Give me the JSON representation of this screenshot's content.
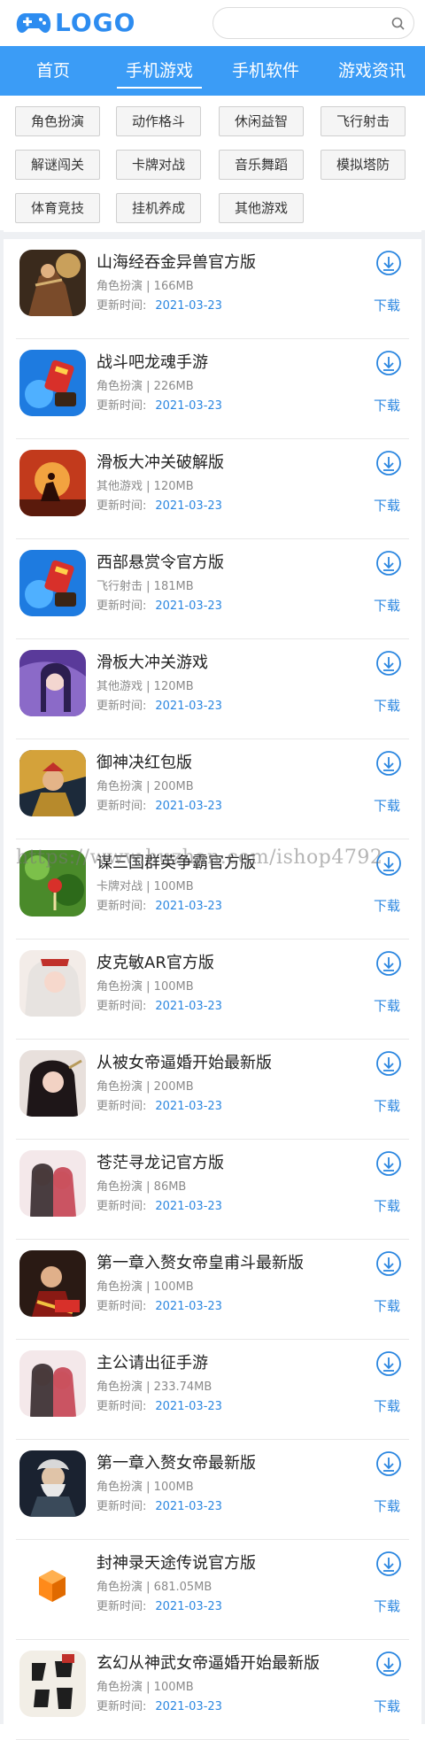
{
  "header": {
    "logo_text": "LOGO",
    "search_placeholder": "",
    "colors": {
      "brand": "#2d8cf0",
      "nav_bg": "#3b9cf6",
      "link": "#2a86e0"
    }
  },
  "nav": {
    "tabs": [
      {
        "label": "首页",
        "active": false
      },
      {
        "label": "手机游戏",
        "active": true
      },
      {
        "label": "手机软件",
        "active": false
      },
      {
        "label": "游戏资讯",
        "active": false
      }
    ]
  },
  "categories": [
    "角色扮演",
    "动作格斗",
    "休闲益智",
    "飞行射击",
    "解谜闯关",
    "卡牌对战",
    "音乐舞蹈",
    "模拟塔防",
    "体育竞技",
    "挂机养成",
    "其他游戏"
  ],
  "list": {
    "time_label": "更新时间:",
    "download_label": "下载",
    "items": [
      {
        "title": "山海经吞金异兽官方版",
        "category": "角色扮演",
        "size": "166MB",
        "date": "2021-03-23",
        "icon": "game-icon-warrior-dark"
      },
      {
        "title": "战斗吧龙魂手游",
        "category": "角色扮演",
        "size": "226MB",
        "date": "2021-03-23",
        "icon": "game-icon-blue-gift"
      },
      {
        "title": "滑板大冲关破解版",
        "category": "其他游戏",
        "size": "120MB",
        "date": "2021-03-23",
        "icon": "game-icon-sunset-rider"
      },
      {
        "title": "西部悬赏令官方版",
        "category": "飞行射击",
        "size": "181MB",
        "date": "2021-03-23",
        "icon": "game-icon-blue-gift"
      },
      {
        "title": "滑板大冲关游戏",
        "category": "其他游戏",
        "size": "120MB",
        "date": "2021-03-23",
        "icon": "game-icon-purple-lady"
      },
      {
        "title": "御神决红包版",
        "category": "角色扮演",
        "size": "200MB",
        "date": "2021-03-23",
        "icon": "game-icon-armored-hero"
      },
      {
        "title": "谋三国群英争霸官方版",
        "category": "卡牌对战",
        "size": "100MB",
        "date": "2021-03-23",
        "icon": "game-icon-green-plant"
      },
      {
        "title": "皮克敏AR官方版",
        "category": "角色扮演",
        "size": "100MB",
        "date": "2021-03-23",
        "icon": "game-icon-white-hair-lady"
      },
      {
        "title": "从被女帝逼婚开始最新版",
        "category": "角色扮演",
        "size": "200MB",
        "date": "2021-03-23",
        "icon": "game-icon-dark-lady"
      },
      {
        "title": "苍茫寻龙记官方版",
        "category": "角色扮演",
        "size": "86MB",
        "date": "2021-03-23",
        "icon": "game-icon-couple"
      },
      {
        "title": "第一章入赘女帝皇甫斗最新版",
        "category": "角色扮演",
        "size": "100MB",
        "date": "2021-03-23",
        "icon": "game-icon-red-warrior"
      },
      {
        "title": "主公请出征手游",
        "category": "角色扮演",
        "size": "233.74MB",
        "date": "2021-03-23",
        "icon": "game-icon-couple"
      },
      {
        "title": "第一章入赘女帝最新版",
        "category": "角色扮演",
        "size": "100MB",
        "date": "2021-03-23",
        "icon": "game-icon-old-master"
      },
      {
        "title": "封神录天途传说官方版",
        "category": "角色扮演",
        "size": "681.05MB",
        "date": "2021-03-23",
        "icon": "game-icon-orange-cube"
      },
      {
        "title": "玄幻从神武女帝逼婚开始最新版",
        "category": "角色扮演",
        "size": "100MB",
        "date": "2021-03-23",
        "icon": "game-icon-calligraphy"
      }
    ]
  },
  "watermark": "https://www.huzhan.com/ishop4792"
}
